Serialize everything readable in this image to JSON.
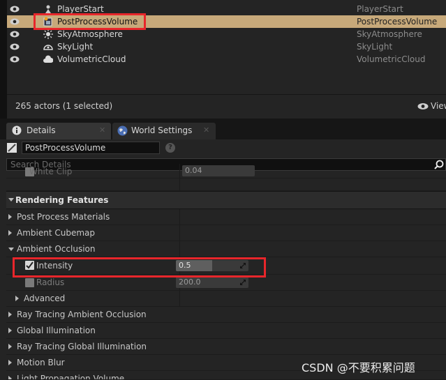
{
  "outliner": {
    "rows": [
      {
        "name": "PlayerStart",
        "type": "PlayerStart",
        "icon": "player-start-icon"
      },
      {
        "name": "PostProcessVolume",
        "type": "PostProcessVolume",
        "icon": "volume-icon",
        "selected": true
      },
      {
        "name": "SkyAtmosphere",
        "type": "SkyAtmosphere",
        "icon": "sun-icon"
      },
      {
        "name": "SkyLight",
        "type": "SkyLight",
        "icon": "skylight-icon"
      },
      {
        "name": "VolumetricCloud",
        "type": "VolumetricCloud",
        "icon": "cloud-icon"
      }
    ],
    "actor_count": "265 actors (1 selected)",
    "view_options_label": "View"
  },
  "tabs": [
    {
      "label": "Details",
      "icon": "info-icon",
      "active": true
    },
    {
      "label": "World Settings",
      "icon": "globe-icon",
      "active": false
    }
  ],
  "details": {
    "object_name": "PostProcessVolume",
    "help_icon": "?",
    "search_placeholder": "Search Details",
    "partial_row": {
      "label": "White Clip",
      "value": "0.04"
    },
    "section_title": "Rendering Features",
    "rows": [
      {
        "label": "Post Process Materials",
        "expanded": false
      },
      {
        "label": "Ambient Cubemap",
        "expanded": false
      },
      {
        "label": "Ambient Occlusion",
        "expanded": true
      }
    ],
    "intensity": {
      "label": "Intensity",
      "value": "0.5",
      "checked": true,
      "fill_fraction": 0.5
    },
    "radius": {
      "label": "Radius",
      "value": "200.0",
      "checked": false
    },
    "advanced_label": "Advanced",
    "more_rows": [
      {
        "label": "Ray Tracing Ambient Occlusion"
      },
      {
        "label": "Global Illumination"
      },
      {
        "label": "Ray Tracing Global Illumination"
      },
      {
        "label": "Motion Blur"
      },
      {
        "label": "Light Propagation Volume"
      }
    ]
  },
  "watermark": "CSDN @不要积累问题",
  "colors": {
    "selection": "#c7a97a",
    "highlight": "#e8262b"
  }
}
